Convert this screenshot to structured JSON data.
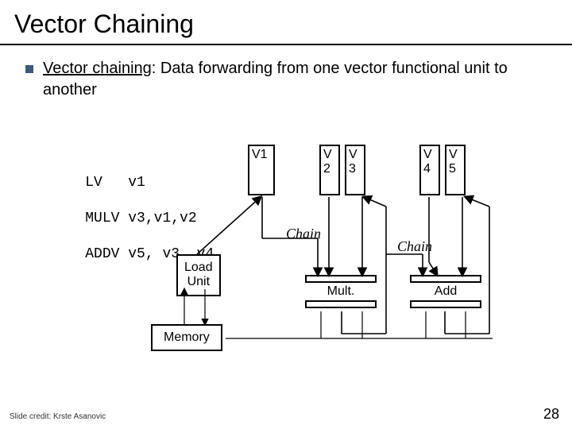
{
  "title": "Vector Chaining",
  "bullet": {
    "term": "Vector chaining",
    "rest": ": Data forwarding from one vector functional unit to another"
  },
  "code": {
    "l1a": "LV   ",
    "l1b": "v1",
    "l2a": "MULV ",
    "l2b": "v3,v1,v2",
    "l3a": "ADDV ",
    "l3b": "v5, v3, v4"
  },
  "regs": {
    "v1": "V1",
    "v2": "V\n2",
    "v3": "V\n3",
    "v4": "V\n4",
    "v5": "V\n5"
  },
  "labels": {
    "chain1": "Chain",
    "chain2": "Chain",
    "load_unit": "Load\nUnit",
    "memory": "Memory",
    "mult": "Mult.",
    "add": "Add"
  },
  "footer": {
    "credit": "Slide credit: Krste Asanovic",
    "page": "28"
  }
}
